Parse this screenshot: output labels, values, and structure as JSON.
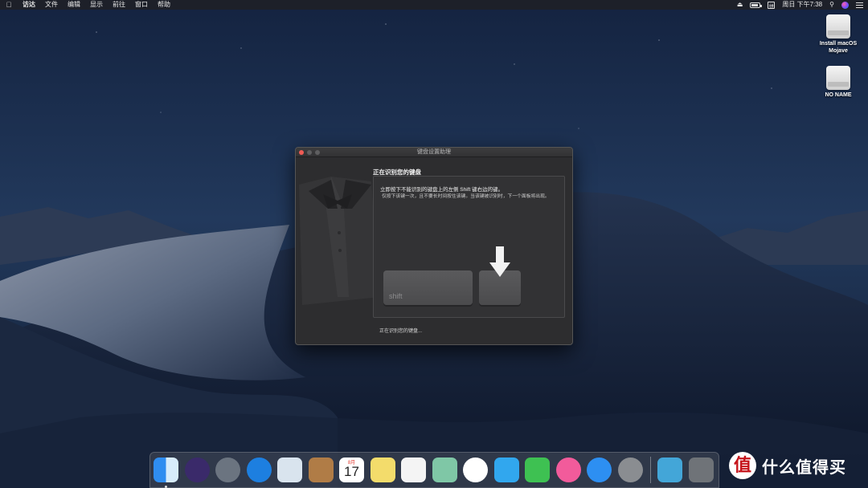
{
  "menubar": {
    "apple_icon": "apple-icon",
    "items": [
      "访达",
      "文件",
      "编辑",
      "显示",
      "前往",
      "窗口",
      "帮助"
    ],
    "battery_percent": 90,
    "ime_label": "拼",
    "clock": "周日 下午7:38"
  },
  "desktop": {
    "drives": [
      {
        "label_line1": "Install macOS",
        "label_line2": "Mojave"
      },
      {
        "label_line1": "NO NAME",
        "label_line2": ""
      }
    ]
  },
  "window": {
    "title": "键盘设置助理",
    "heading": "正在识别您的键盘",
    "instruction": "立即按下不能识别的键盘上的左侧 Shift 键右边的键。",
    "note": "仅按下该键一次，且不要长时间按住该键。当该键被识别时，下一个面板将出现。",
    "shift_key_label": "shift",
    "status": "正在识别您的键盘..."
  },
  "dock": {
    "apps": [
      {
        "name": "finder",
        "color": "#2f8df0"
      },
      {
        "name": "siri",
        "color": "#3a2a6a"
      },
      {
        "name": "launchpad",
        "color": "#6b7480"
      },
      {
        "name": "safari",
        "color": "#1d7fe0"
      },
      {
        "name": "mail",
        "color": "#d9e4ee"
      },
      {
        "name": "contacts",
        "color": "#b07c46"
      },
      {
        "name": "calendar",
        "color": "#ffffff",
        "day": "17",
        "month": "8月"
      },
      {
        "name": "notes",
        "color": "#f3dc6b"
      },
      {
        "name": "reminders",
        "color": "#f4f4f4"
      },
      {
        "name": "maps",
        "color": "#7fc7a6"
      },
      {
        "name": "photos",
        "color": "#ffffff"
      },
      {
        "name": "messages",
        "color": "#31a7ee"
      },
      {
        "name": "facetime",
        "color": "#3ec152"
      },
      {
        "name": "itunes",
        "color": "#f25b9b"
      },
      {
        "name": "app-store",
        "color": "#2d8ff2"
      },
      {
        "name": "system-preferences",
        "color": "#8a8d91"
      }
    ],
    "others": [
      {
        "name": "downloads",
        "color": "#43a6d8"
      },
      {
        "name": "trash",
        "color": "#6f7378"
      }
    ]
  },
  "watermark": {
    "text": "什么值得买",
    "logo": "值"
  }
}
